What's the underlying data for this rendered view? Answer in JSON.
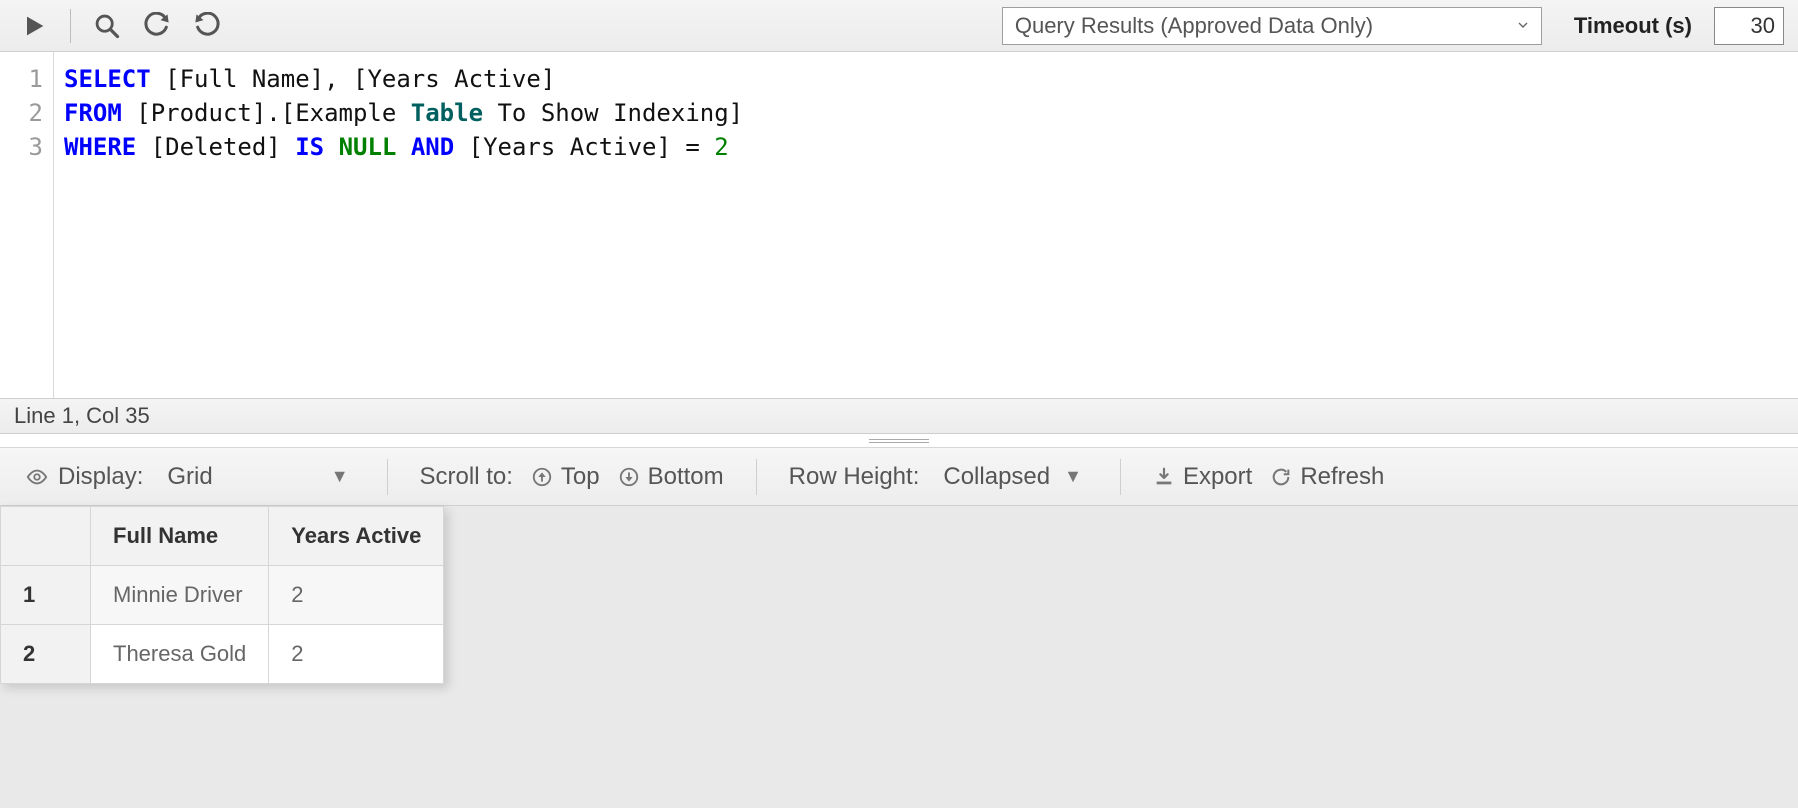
{
  "toolbar": {
    "run": "Run",
    "search": "Search",
    "undo": "Undo",
    "redo": "Redo",
    "results_mode": "Query Results (Approved Data Only)",
    "timeout_label": "Timeout (s)",
    "timeout_value": "30"
  },
  "editor": {
    "lines": [
      "1",
      "2",
      "3"
    ],
    "cursor": "Line 1, Col 35",
    "sql": {
      "l1": {
        "kw": "SELECT",
        "rest": " [Full Name], [Years Active]"
      },
      "l2": {
        "kw": "FROM",
        "mid1": " [Product].[Example ",
        "kw2": "Table",
        "mid2": " To Show Indexing]"
      },
      "l3": {
        "kw": "WHERE",
        "mid1": " [Deleted] ",
        "is": "IS",
        "sp1": " ",
        "nul": "NULL",
        "sp2": " ",
        "and": "AND",
        "mid2": " [Years Active] = ",
        "num": "2"
      }
    }
  },
  "results_toolbar": {
    "display_label": "Display:",
    "display_value": "Grid",
    "scroll_label": "Scroll to:",
    "top": "Top",
    "bottom": "Bottom",
    "rowheight_label": "Row Height:",
    "rowheight_value": "Collapsed",
    "export": "Export",
    "refresh": "Refresh"
  },
  "grid": {
    "headers": {
      "c0": "",
      "c1": "Full Name",
      "c2": "Years Active"
    },
    "rows": [
      {
        "n": "1",
        "name": "Minnie Driver",
        "years": "2"
      },
      {
        "n": "2",
        "name": "Theresa Gold",
        "years": "2"
      }
    ]
  }
}
